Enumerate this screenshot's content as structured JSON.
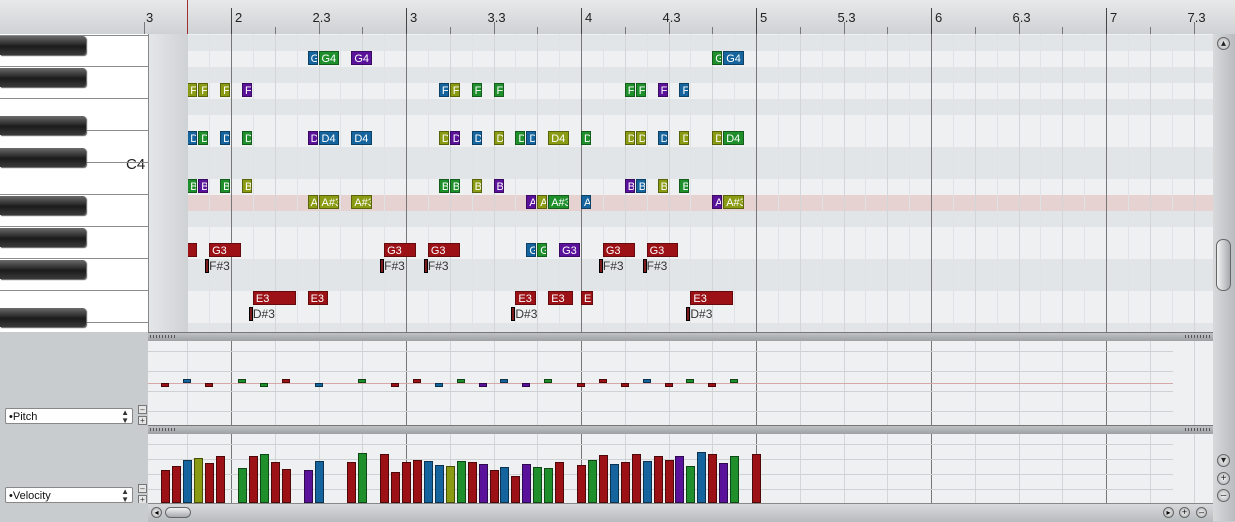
{
  "ruler": {
    "labels": [
      "3",
      "2",
      "2.3",
      "3",
      "3.3",
      "4",
      "4.3",
      "5",
      "5.3",
      "6",
      "6.3",
      "7",
      "7.3"
    ]
  },
  "keyboard": {
    "c4_label": "C4"
  },
  "notes": [
    {
      "pitch": "G4",
      "start": 1.75,
      "dur": 0.25,
      "color": "blue"
    },
    {
      "pitch": "G4",
      "start": 2.0,
      "dur": 0.5,
      "color": "green"
    },
    {
      "pitch": "G4",
      "start": 2.75,
      "dur": 0.5,
      "color": "purple"
    },
    {
      "pitch": "G4",
      "start": 11.0,
      "dur": 0.25,
      "color": "green"
    },
    {
      "pitch": "G4",
      "start": 11.25,
      "dur": 0.5,
      "color": "blue"
    },
    {
      "pitch": "F4",
      "start": -1.0,
      "dur": 0.25,
      "color": "olive"
    },
    {
      "pitch": "F4",
      "start": -0.75,
      "dur": 0.25,
      "color": "olive"
    },
    {
      "pitch": "F4",
      "start": -0.25,
      "dur": 0.25,
      "color": "olive"
    },
    {
      "pitch": "F4",
      "start": 0.25,
      "dur": 0.25,
      "color": "purple"
    },
    {
      "pitch": "F4",
      "start": 4.75,
      "dur": 0.25,
      "color": "blue"
    },
    {
      "pitch": "F4",
      "start": 5.0,
      "dur": 0.25,
      "color": "olive"
    },
    {
      "pitch": "F4",
      "start": 5.5,
      "dur": 0.25,
      "color": "green"
    },
    {
      "pitch": "F4",
      "start": 6.0,
      "dur": 0.25,
      "color": "green"
    },
    {
      "pitch": "F4",
      "start": 9.0,
      "dur": 0.25,
      "color": "green"
    },
    {
      "pitch": "F4",
      "start": 9.25,
      "dur": 0.25,
      "color": "green"
    },
    {
      "pitch": "F4",
      "start": 9.75,
      "dur": 0.25,
      "color": "purple"
    },
    {
      "pitch": "F4",
      "start": 10.25,
      "dur": 0.25,
      "color": "blue"
    },
    {
      "pitch": "D4",
      "start": -1.0,
      "dur": 0.25,
      "color": "blue"
    },
    {
      "pitch": "D4",
      "start": -0.75,
      "dur": 0.25,
      "color": "green"
    },
    {
      "pitch": "D4",
      "start": -0.25,
      "dur": 0.25,
      "color": "blue"
    },
    {
      "pitch": "D4",
      "start": 0.25,
      "dur": 0.25,
      "color": "green"
    },
    {
      "pitch": "D4",
      "start": 1.75,
      "dur": 0.25,
      "color": "purple"
    },
    {
      "pitch": "D4",
      "start": 2.0,
      "dur": 0.5,
      "color": "blue"
    },
    {
      "pitch": "D4",
      "start": 2.75,
      "dur": 0.5,
      "color": "blue"
    },
    {
      "pitch": "D4",
      "start": 4.75,
      "dur": 0.25,
      "color": "olive"
    },
    {
      "pitch": "D4",
      "start": 5.0,
      "dur": 0.25,
      "color": "purple"
    },
    {
      "pitch": "D4",
      "start": 5.5,
      "dur": 0.25,
      "color": "blue"
    },
    {
      "pitch": "D4",
      "start": 6.0,
      "dur": 0.25,
      "color": "olive"
    },
    {
      "pitch": "D4",
      "start": 6.5,
      "dur": 0.25,
      "color": "green"
    },
    {
      "pitch": "D4",
      "start": 6.75,
      "dur": 0.25,
      "color": "blue"
    },
    {
      "pitch": "D4",
      "start": 7.25,
      "dur": 0.5,
      "color": "olive"
    },
    {
      "pitch": "D4",
      "start": 8.0,
      "dur": 0.25,
      "color": "green"
    },
    {
      "pitch": "D4",
      "start": 9.0,
      "dur": 0.25,
      "color": "olive"
    },
    {
      "pitch": "D4",
      "start": 9.25,
      "dur": 0.25,
      "color": "olive"
    },
    {
      "pitch": "D4",
      "start": 9.75,
      "dur": 0.25,
      "color": "blue"
    },
    {
      "pitch": "D4",
      "start": 10.25,
      "dur": 0.25,
      "color": "olive"
    },
    {
      "pitch": "D4",
      "start": 11.0,
      "dur": 0.25,
      "color": "olive"
    },
    {
      "pitch": "D4",
      "start": 11.25,
      "dur": 0.5,
      "color": "green"
    },
    {
      "pitch": "B3",
      "start": -1.0,
      "dur": 0.25,
      "color": "green"
    },
    {
      "pitch": "B3",
      "start": -0.75,
      "dur": 0.25,
      "color": "purple"
    },
    {
      "pitch": "B3",
      "start": -0.25,
      "dur": 0.25,
      "color": "green"
    },
    {
      "pitch": "B3",
      "start": 0.25,
      "dur": 0.25,
      "color": "olive"
    },
    {
      "pitch": "B3",
      "start": 4.75,
      "dur": 0.25,
      "color": "green"
    },
    {
      "pitch": "B3",
      "start": 5.0,
      "dur": 0.25,
      "color": "green"
    },
    {
      "pitch": "B3",
      "start": 5.5,
      "dur": 0.25,
      "color": "olive"
    },
    {
      "pitch": "B3",
      "start": 6.0,
      "dur": 0.25,
      "color": "purple"
    },
    {
      "pitch": "B3",
      "start": 9.0,
      "dur": 0.25,
      "color": "purple"
    },
    {
      "pitch": "B3",
      "start": 9.25,
      "dur": 0.25,
      "color": "blue"
    },
    {
      "pitch": "B3",
      "start": 9.75,
      "dur": 0.25,
      "color": "olive"
    },
    {
      "pitch": "B3",
      "start": 10.25,
      "dur": 0.25,
      "color": "green"
    },
    {
      "pitch": "A#3",
      "start": 1.75,
      "dur": 0.25,
      "color": "olive"
    },
    {
      "pitch": "A#3",
      "start": 2.0,
      "dur": 0.5,
      "color": "olive"
    },
    {
      "pitch": "A#3",
      "start": 2.75,
      "dur": 0.5,
      "color": "olive"
    },
    {
      "pitch": "A#3",
      "start": 6.75,
      "dur": 0.2,
      "color": "purple"
    },
    {
      "pitch": "A#3",
      "start": 7.0,
      "dur": 0.2,
      "color": "olive"
    },
    {
      "pitch": "A#3",
      "start": 7.25,
      "dur": 0.5,
      "color": "green"
    },
    {
      "pitch": "A#3",
      "start": 8.0,
      "dur": 0.2,
      "color": "blue"
    },
    {
      "pitch": "A#3",
      "start": 11.0,
      "dur": 0.25,
      "color": "purple"
    },
    {
      "pitch": "A#3",
      "start": 11.25,
      "dur": 0.5,
      "color": "olive"
    },
    {
      "pitch": "G3",
      "start": -1.5,
      "dur": 0.75,
      "color": "red"
    },
    {
      "pitch": "G3",
      "start": -0.5,
      "dur": 0.75,
      "color": "red"
    },
    {
      "pitch": "G3",
      "start": 3.5,
      "dur": 0.75,
      "color": "red"
    },
    {
      "pitch": "G3",
      "start": 4.5,
      "dur": 0.75,
      "color": "red"
    },
    {
      "pitch": "G3",
      "start": 6.75,
      "dur": 0.2,
      "color": "blue"
    },
    {
      "pitch": "G3",
      "start": 7.0,
      "dur": 0.25,
      "color": "green"
    },
    {
      "pitch": "G3",
      "start": 7.5,
      "dur": 0.5,
      "color": "purple"
    },
    {
      "pitch": "G3",
      "start": 8.5,
      "dur": 0.75,
      "color": "red"
    },
    {
      "pitch": "G3",
      "start": 9.5,
      "dur": 0.75,
      "color": "red"
    },
    {
      "pitch": "E3",
      "start": 0.5,
      "dur": 1.0,
      "color": "red"
    },
    {
      "pitch": "E3",
      "start": 1.75,
      "dur": 0.5,
      "color": "red"
    },
    {
      "pitch": "E3",
      "start": 6.5,
      "dur": 0.5,
      "color": "red"
    },
    {
      "pitch": "E3",
      "start": 7.25,
      "dur": 0.6,
      "color": "red"
    },
    {
      "pitch": "E3",
      "start": 8.0,
      "dur": 0.3,
      "color": "red"
    },
    {
      "pitch": "E3",
      "start": 10.5,
      "dur": 1.0,
      "color": "red"
    }
  ],
  "grace_notes": [
    {
      "pitch": "F#3",
      "start": -1.5,
      "label": "F#3"
    },
    {
      "pitch": "F#3",
      "start": -0.5,
      "label": "F#3"
    },
    {
      "pitch": "F#3",
      "start": 3.5,
      "label": "F#3"
    },
    {
      "pitch": "F#3",
      "start": 4.5,
      "label": "F#3"
    },
    {
      "pitch": "F#3",
      "start": 8.5,
      "label": "F#3"
    },
    {
      "pitch": "F#3",
      "start": 9.5,
      "label": "F#3"
    },
    {
      "pitch": "D#3",
      "start": 0.5,
      "label": "D#3"
    },
    {
      "pitch": "D#3",
      "start": 6.5,
      "label": "D#3"
    },
    {
      "pitch": "D#3",
      "start": 10.5,
      "label": "D#3"
    }
  ],
  "lanes": {
    "pitch_label": "•Pitch",
    "velocity_label": "•Velocity"
  },
  "colors": {
    "red": "#9b1115",
    "green": "#1f8f2c",
    "blue": "#16649d",
    "purple": "#5b129a",
    "olive": "#8a9a12",
    "grace": "#7a1a1a"
  }
}
